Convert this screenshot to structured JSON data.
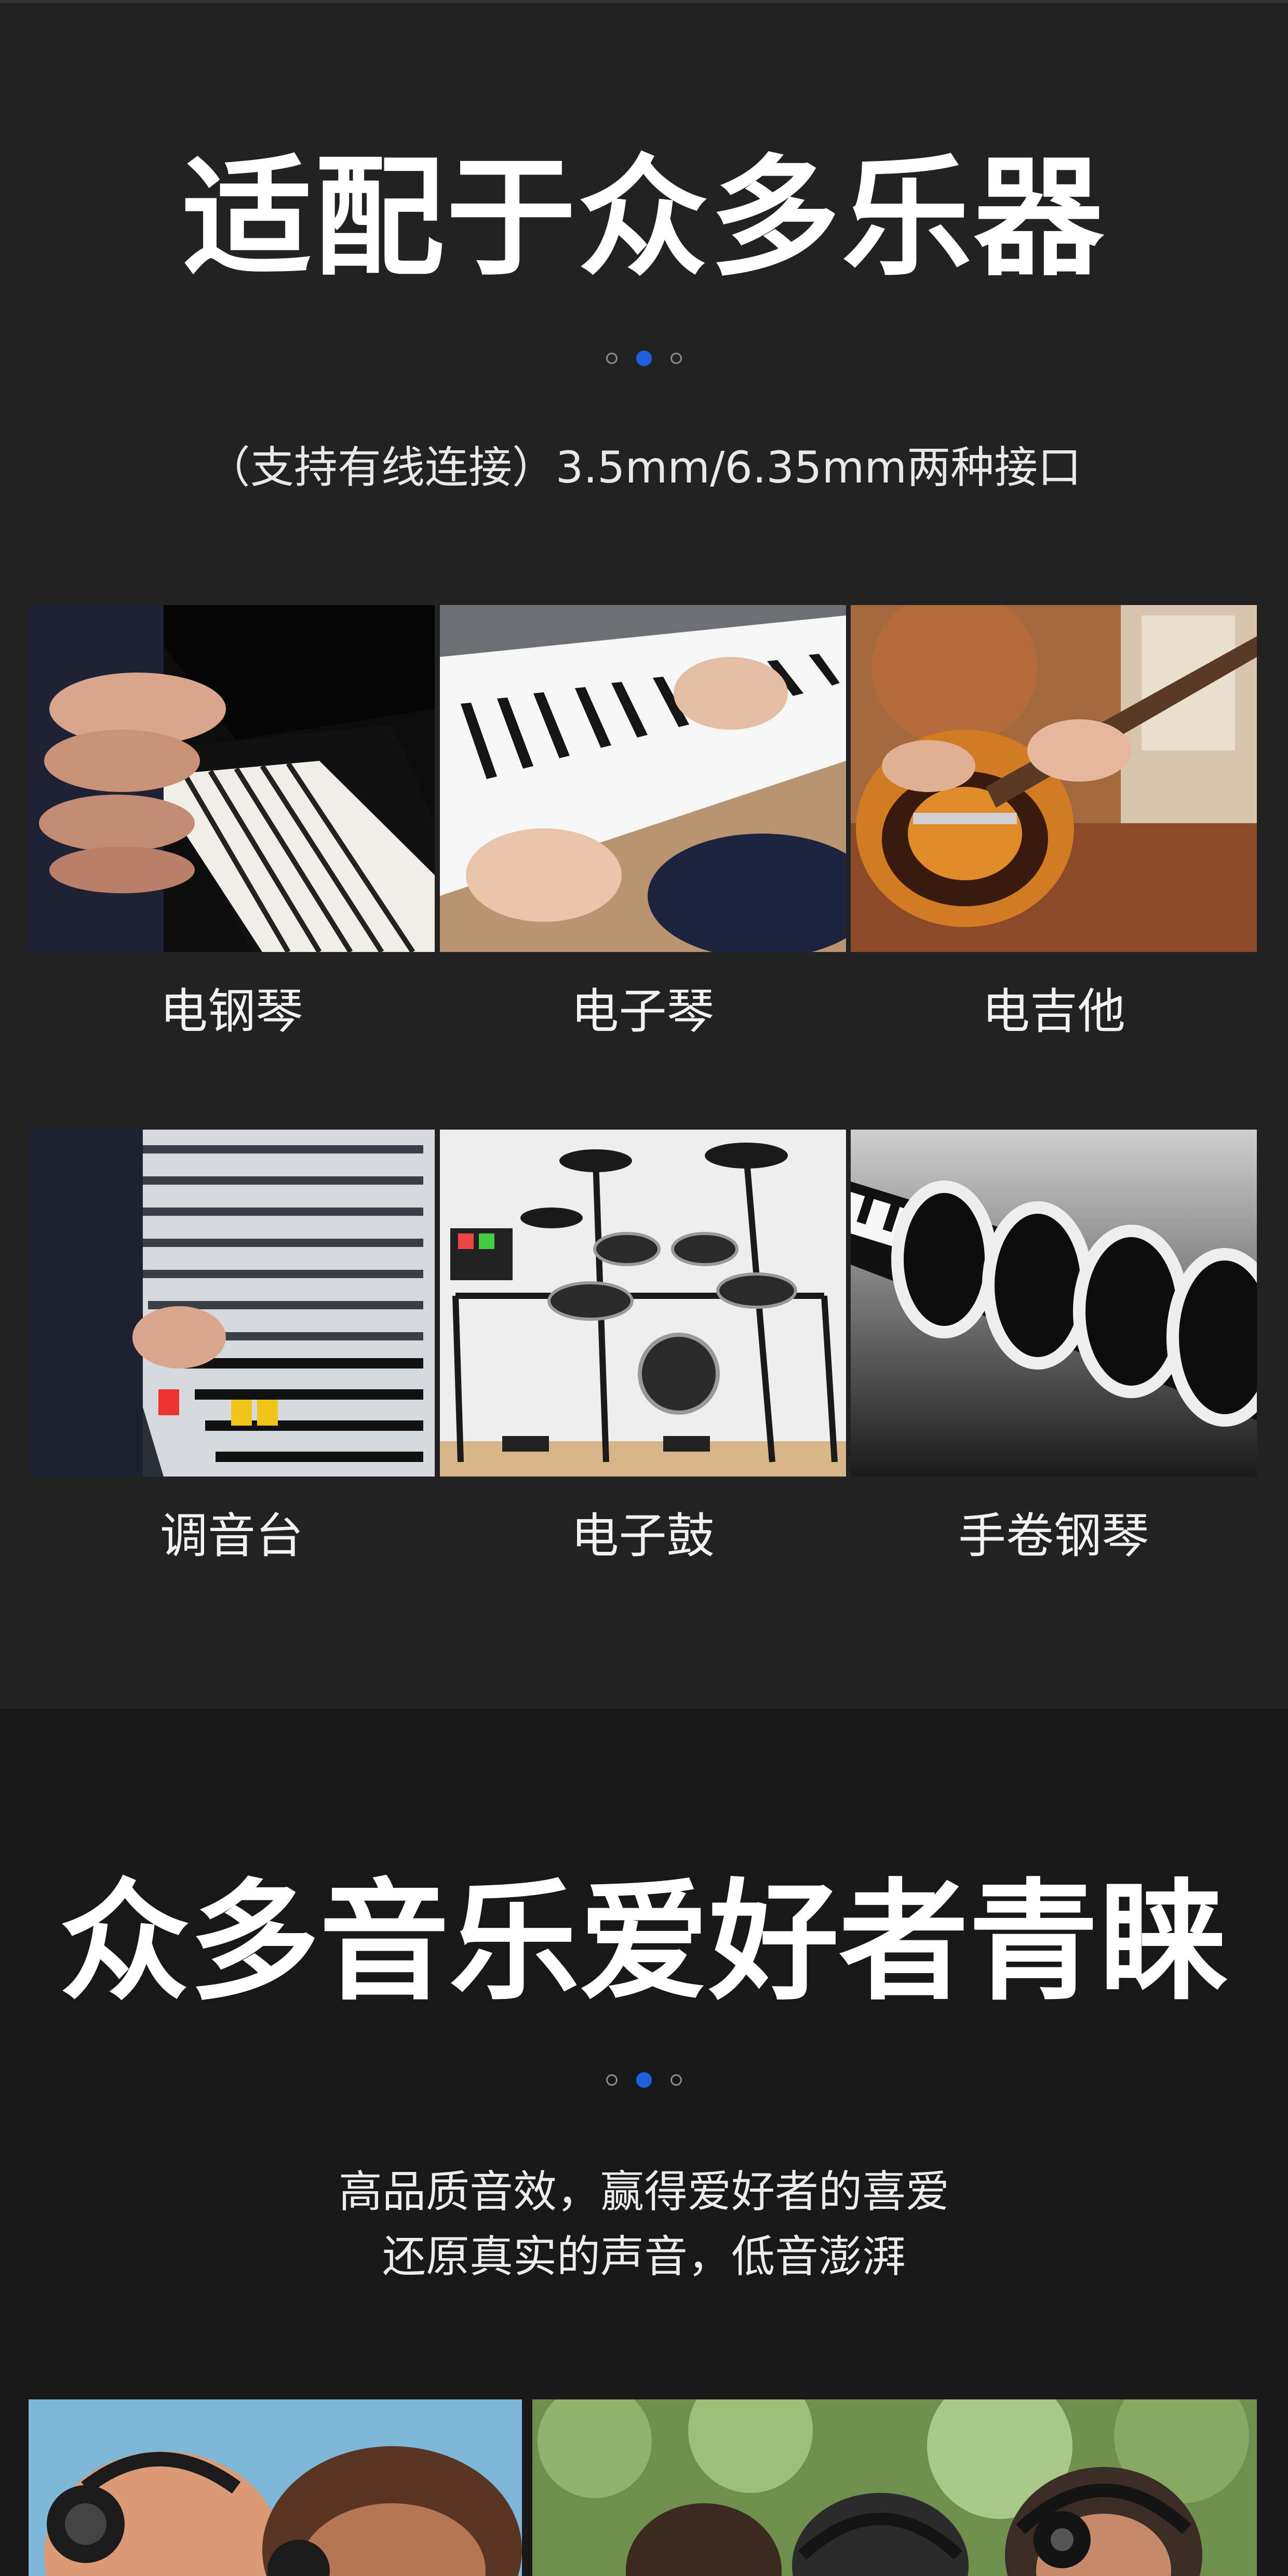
{
  "section1": {
    "title": "适配于众多乐器",
    "subtitle": "（支持有线连接）3.5mm/6.35mm两种接口",
    "instruments": [
      {
        "label": "电钢琴",
        "icon": "piano-photo"
      },
      {
        "label": "电子琴",
        "icon": "keyboard-photo"
      },
      {
        "label": "电吉他",
        "icon": "guitar-photo"
      },
      {
        "label": "调音台",
        "icon": "mixer-photo"
      },
      {
        "label": "电子鼓",
        "icon": "drum-kit-photo"
      },
      {
        "label": "手卷钢琴",
        "icon": "roll-piano-photo"
      }
    ]
  },
  "section2": {
    "title": "众多音乐爱好者青睐",
    "line1": "高品质音效，赢得爱好者的喜爱",
    "line2": "还原真实的声音，低音澎湃"
  },
  "colors": {
    "accent": "#1f5fe0",
    "bg_top": "#222222",
    "bg_bottom": "#181818"
  }
}
